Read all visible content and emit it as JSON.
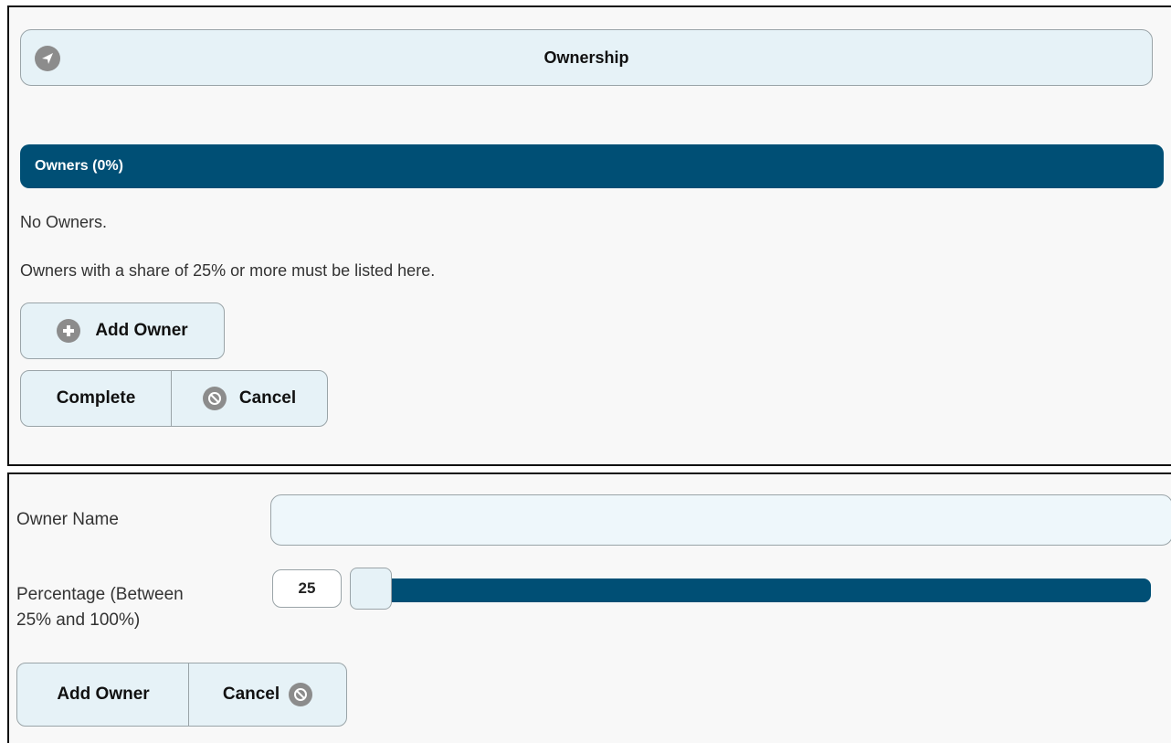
{
  "ownership_panel": {
    "title": "Ownership",
    "title_icon": "navigation-arrow-icon",
    "owners_section": {
      "header": "Owners (0%)",
      "empty_message": "No Owners.",
      "note": "Owners with a share of 25% or more must be listed here."
    },
    "buttons": {
      "add_owner": "Add Owner",
      "complete": "Complete",
      "cancel": "Cancel"
    }
  },
  "add_owner_form": {
    "owner_name_label": "Owner Name",
    "owner_name_value": "",
    "percentage_label_line1": "Percentage (Between",
    "percentage_label_line2": "25% and 100%)",
    "percentage_value": "25",
    "slider": {
      "min": 25,
      "max": 100,
      "value": 25
    },
    "buttons": {
      "add_owner": "Add Owner",
      "cancel": "Cancel"
    }
  },
  "colors": {
    "accent": "#004f75",
    "button_bg": "#e6f2f7",
    "icon_gray": "#8c8c8c"
  }
}
